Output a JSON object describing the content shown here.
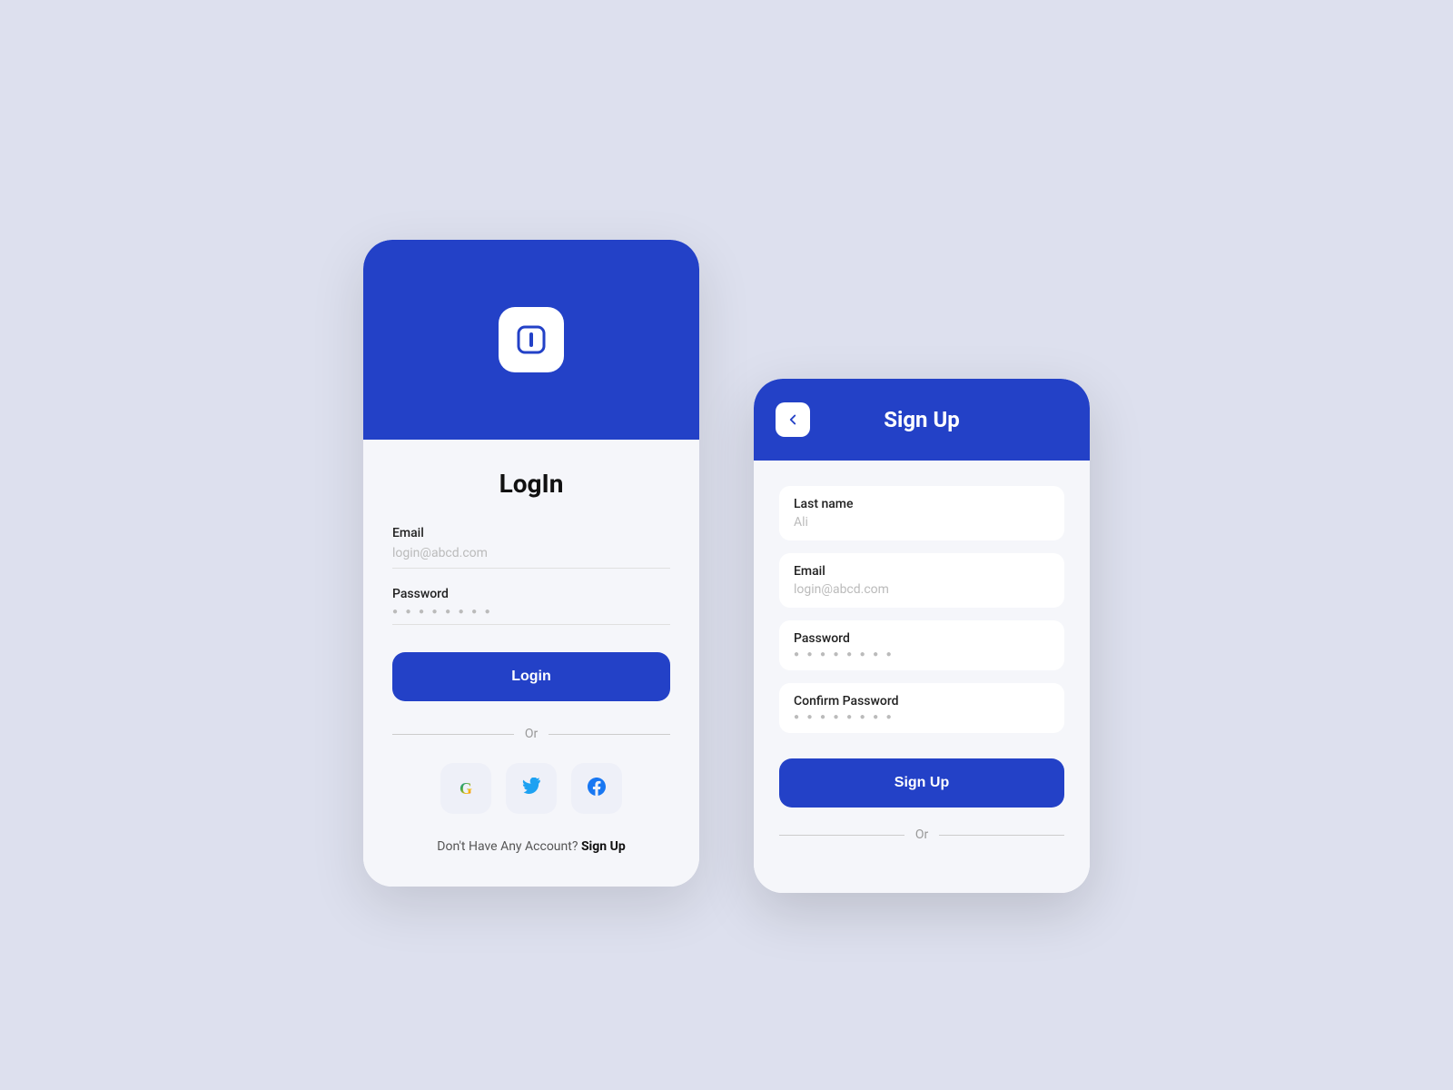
{
  "background": "#dde0ee",
  "accent_color": "#2341c7",
  "login": {
    "header_bg": "#2341c7",
    "title": "LogIn",
    "email_label": "Email",
    "email_placeholder": "login@abcd.com",
    "password_label": "Password",
    "password_dots": "● ● ● ● ● ● ● ●",
    "login_button": "Login",
    "or_text": "Or",
    "no_account_text": "Don't Have Any Account?",
    "signup_link": "Sign Up"
  },
  "signup": {
    "header_bg": "#2341c7",
    "title": "Sign Up",
    "back_icon": "←",
    "lastname_label": "Last name",
    "lastname_value": "Ali",
    "email_label": "Email",
    "email_placeholder": "login@abcd.com",
    "password_label": "Password",
    "password_dots": "● ● ● ● ● ● ● ●",
    "confirm_password_label": "Confirm Password",
    "confirm_password_dots": "● ● ● ● ● ● ● ●",
    "signup_button": "Sign Up",
    "or_text": "Or"
  },
  "social": {
    "google_label": "G",
    "twitter_label": "Twitter",
    "facebook_label": "Facebook"
  }
}
